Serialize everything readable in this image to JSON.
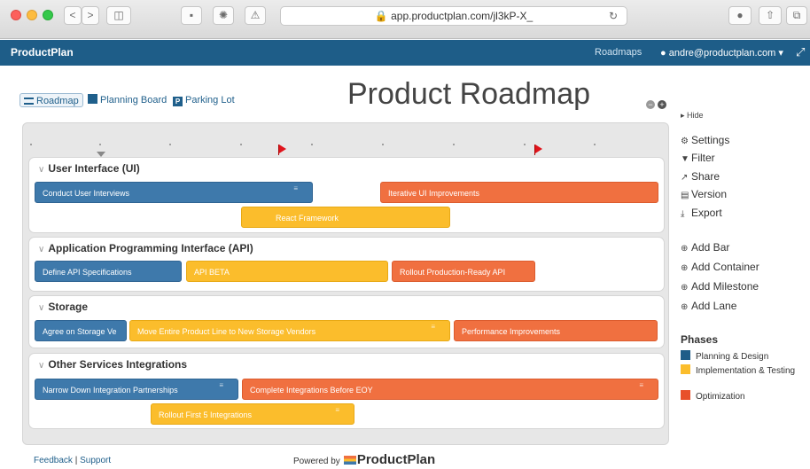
{
  "browser": {
    "url": "app.productplan.com/jl3kP-X_",
    "back_label": "<",
    "forward_label": ">"
  },
  "header": {
    "brand": "ProductPlan",
    "roadmaps_link": "Roadmaps",
    "user": "andre@productplan.com"
  },
  "tabs": [
    {
      "label": "Roadmap"
    },
    {
      "label": "Planning Board"
    },
    {
      "label": "Parking Lot"
    }
  ],
  "page_title": "Product Roadmap",
  "lanes": [
    {
      "title": "User Interface (UI)"
    },
    {
      "title": "Application Programming Interface (API)"
    },
    {
      "title": "Storage"
    },
    {
      "title": "Other Services Integrations"
    }
  ],
  "bars": {
    "ui_1": "Conduct User Interviews",
    "ui_2": "Iterative UI Improvements",
    "ui_3": "React Framework",
    "api_1": "Define API Specifications",
    "api_2": "API BETA",
    "api_3": "Rollout Production-Ready API",
    "st_1": "Agree on Storage Ve",
    "st_2": "Move Entire Product Line to New Storage Vendors",
    "st_3": "Performance Improvements",
    "os_1": "Narrow Down Integration Partnerships",
    "os_2": "Complete Integrations Before EOY",
    "os_3": "Rollout First 5 Integrations"
  },
  "sidebar": {
    "hide": "Hide",
    "settings": "Settings",
    "filter": "Filter",
    "share": "Share",
    "version": "Version",
    "export": "Export",
    "add_bar": "Add Bar",
    "add_container": "Add Container",
    "add_milestone": "Add Milestone",
    "add_lane": "Add Lane"
  },
  "phases": {
    "heading": "Phases",
    "items": [
      {
        "label": "Planning & Design",
        "color": "#1e5d88"
      },
      {
        "label": "Implementation & Testing",
        "color": "#fbbd2c"
      },
      {
        "label": "Optimization",
        "color": "#e8502a"
      }
    ]
  },
  "footer": {
    "feedback": "Feedback",
    "separator": "|",
    "support": "Support",
    "powered_by": "Powered by",
    "logo_text": "ProductPlan"
  },
  "colors": {
    "header_bg": "#1e5d88",
    "bar_blue": "#3e79ab",
    "bar_orange": "#f07040",
    "bar_yellow": "#fbbd2c"
  }
}
